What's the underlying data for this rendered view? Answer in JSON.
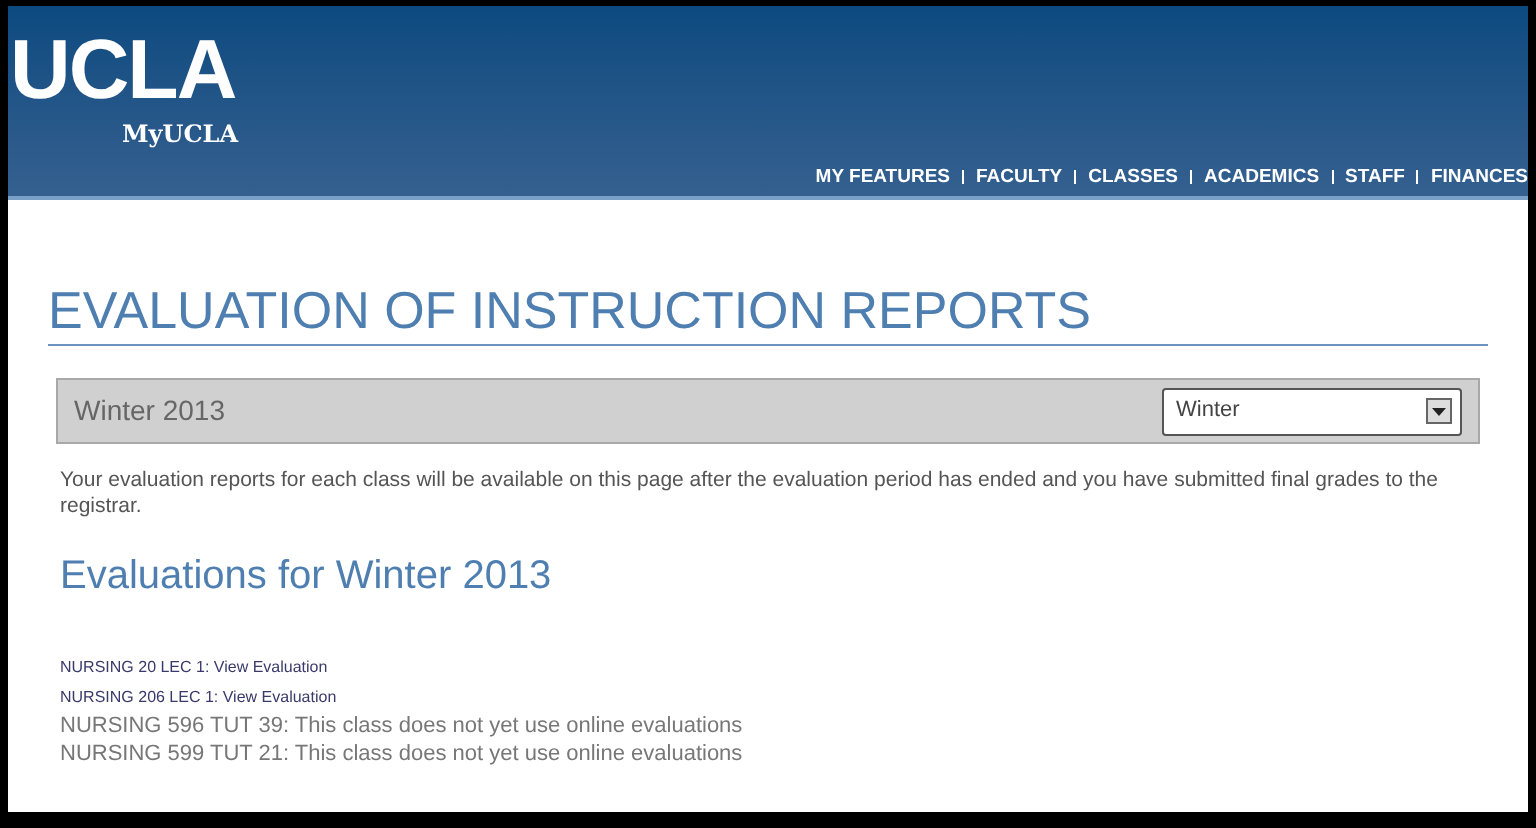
{
  "header": {
    "logo": "UCLA",
    "subtitle": "MyUCLA"
  },
  "nav": [
    "MY FEATURES",
    "FACULTY",
    "CLASSES",
    "ACADEMICS",
    "STAFF",
    "FINANCES"
  ],
  "title": "EVALUATION OF INSTRUCTION REPORTS",
  "term_bar": {
    "label": "Winter 2013",
    "select": {
      "value": "Winter"
    }
  },
  "notice": "Your evaluation reports for each class will be available on this page after the evaluation period has ended and you have submitted final grades to the registrar.",
  "section_heading": "Evaluations for Winter 2013",
  "classes": [
    {
      "kind": "link",
      "text": "NURSING 20 LEC 1: View Evaluation"
    },
    {
      "kind": "link",
      "text": "NURSING 206 LEC 1: View Evaluation"
    },
    {
      "kind": "note",
      "text": "NURSING 596 TUT 39: This class does not yet use online evaluations"
    },
    {
      "kind": "note",
      "text": "NURSING 599 TUT 21: This class does not yet use online evaluations"
    }
  ]
}
